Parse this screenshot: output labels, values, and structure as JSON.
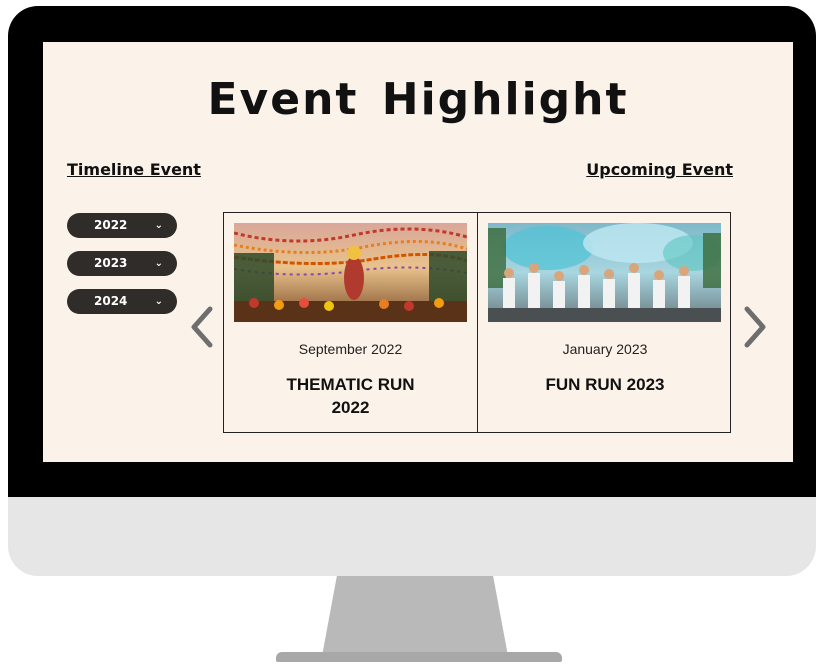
{
  "header": {
    "title": "Event Highlight"
  },
  "sections": {
    "timeline_label": "Timeline Event",
    "upcoming_label": "Upcoming Event"
  },
  "years": [
    {
      "label": "2022",
      "icon": "chevron-down-icon"
    },
    {
      "label": "2023",
      "icon": "chevron-down-icon"
    },
    {
      "label": "2024",
      "icon": "chevron-down-icon"
    }
  ],
  "navigation": {
    "prev_icon": "chevron-left-icon",
    "next_icon": "chevron-right-icon"
  },
  "events": [
    {
      "date": "September 2022",
      "title_line1": "THEMATIC RUN",
      "title_line2": "2022",
      "image": "festival-parade-photo"
    },
    {
      "date": "January 2023",
      "title_line1": "FUN RUN 2023",
      "title_line2": "",
      "image": "color-run-photo"
    }
  ],
  "colors": {
    "screen_bg": "#fbf3ea",
    "pill_bg": "#2f2c29",
    "bezel": "#000000",
    "monitor_body": "#e6e6e6",
    "stand": "#b9b9b9"
  }
}
